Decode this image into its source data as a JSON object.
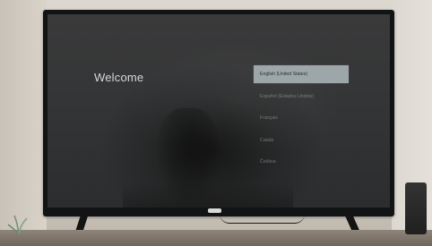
{
  "screen": {
    "welcome_title": "Welcome",
    "languages": [
      {
        "label": "English (United States)",
        "selected": true
      },
      {
        "label": "Español (Estados Unidos)",
        "selected": false
      },
      {
        "label": "Français",
        "selected": false
      },
      {
        "label": "Català",
        "selected": false
      },
      {
        "label": "Čeština",
        "selected": false
      }
    ]
  },
  "colors": {
    "selected_background": "#9da6a8",
    "screen_background": "#343536"
  }
}
